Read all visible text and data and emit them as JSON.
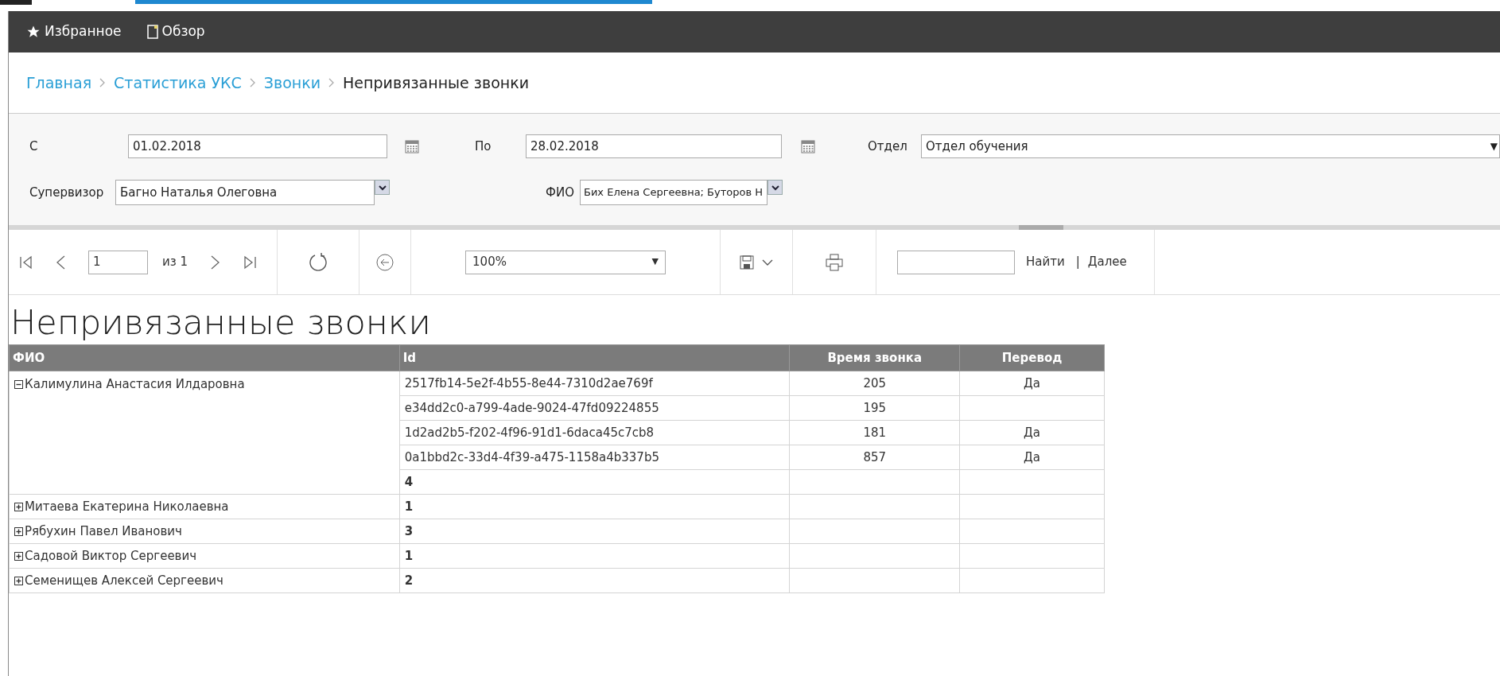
{
  "nav": [
    {
      "kind": "star",
      "label": "Избранное"
    },
    {
      "kind": "page",
      "label": "Обзор"
    }
  ],
  "breadcrumb": [
    {
      "label": "Главная",
      "link": true
    },
    {
      "label": "Статистика УКС",
      "link": true
    },
    {
      "label": "Звонки",
      "link": true
    },
    {
      "label": "Непривязанные звонки",
      "link": false
    }
  ],
  "filters": {
    "from": {
      "label": "С",
      "value": "01.02.2018"
    },
    "to": {
      "label": "По",
      "value": "28.02.2018"
    },
    "department": {
      "label": "Отдел",
      "value": "Отдел обучения",
      "arrow": "▼"
    },
    "supervisor": {
      "label": "Супервизор",
      "value": "Багно Наталья Олеговна"
    },
    "person": {
      "label": "ФИО",
      "value": "Бих Елена Сергеевна; Буторов Н"
    }
  },
  "toolbar": {
    "page": "1",
    "of": "из 1",
    "zoom": "100%",
    "zoom_arrow": "▼",
    "find": "Найти",
    "separator": "|",
    "next": "Далее"
  },
  "report": {
    "title": "Непривязанные звонки",
    "columns": [
      "ФИО",
      "Id",
      "Время звонка",
      "Перевод"
    ],
    "groups": [
      {
        "name": "Калимулина Анастасия Илдаровна",
        "expanded": true,
        "count": "4",
        "rows": [
          {
            "id": "2517fb14-5e2f-4b55-8e44-7310d2ae769f",
            "time": "205",
            "transfer": "Да"
          },
          {
            "id": "e34dd2c0-a799-4ade-9024-47fd09224855",
            "time": "195"
          },
          {
            "id": "1d2ad2b5-f202-4f96-91d1-6daca45c7cb8",
            "time": "181",
            "transfer": "Да"
          },
          {
            "id": "0a1bbd2c-33d4-4f39-a475-1158a4b337b5",
            "time": "857",
            "transfer": "Да"
          }
        ]
      },
      {
        "name": "Митаева Екатерина Николаевна",
        "expanded": false,
        "count": "1"
      },
      {
        "name": "Рябухин Павел Иванович",
        "expanded": false,
        "count": "3"
      },
      {
        "name": "Садовой Виктор Сергеевич",
        "expanded": false,
        "count": "1"
      },
      {
        "name": "Семенищев Алексей Сергеевич",
        "expanded": false,
        "count": "2"
      }
    ]
  }
}
